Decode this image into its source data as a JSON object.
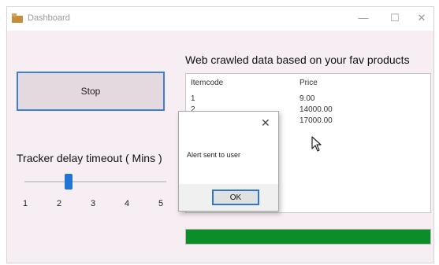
{
  "window": {
    "title": "Dashboard",
    "controls": {
      "minimize": "—",
      "maximize": "☐",
      "close": "✕"
    }
  },
  "top_caption": "",
  "stop_button": {
    "label": "Stop"
  },
  "tracker": {
    "label": "Tracker delay timeout ( Mins )",
    "value": 2,
    "min": 1,
    "max": 5,
    "ticks": [
      "1",
      "2",
      "3",
      "4",
      "5"
    ]
  },
  "results": {
    "title": "Web crawled data based on your fav products",
    "columns": [
      "Itemcode",
      "Price"
    ],
    "rows": [
      [
        "1",
        "9.00"
      ],
      [
        "2",
        "14000.00"
      ],
      [
        "",
        "17000.00"
      ]
    ]
  },
  "dialog": {
    "message": "Alert sent to user",
    "ok_label": "OK",
    "close_glyph": "✕"
  },
  "progress": {
    "value": 1.0,
    "color": "#0b8d2a"
  },
  "colors": {
    "accent": "#1f74d4",
    "progress": "#0b8d2a",
    "window_bg": "#f7eef3"
  }
}
